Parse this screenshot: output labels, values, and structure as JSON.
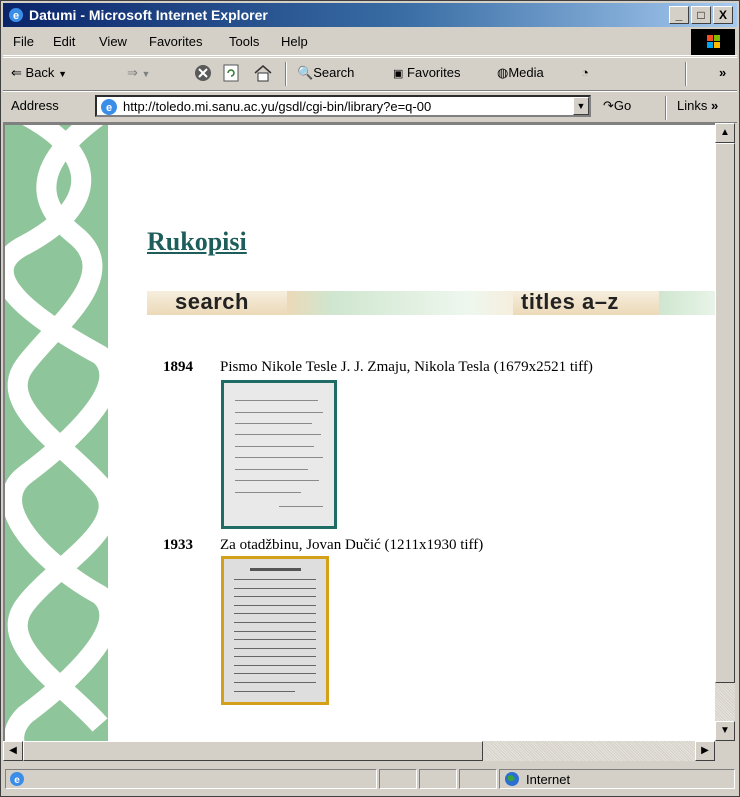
{
  "window": {
    "title": "Datumi - Microsoft Internet Explorer",
    "controls": {
      "minimize": "_",
      "maximize": "□",
      "close": "X"
    }
  },
  "menu": [
    "File",
    "Edit",
    "View",
    "Favorites",
    "Tools",
    "Help"
  ],
  "toolbar": {
    "back": "Back",
    "search": "Search",
    "favorites": "Favorites",
    "media": "Media",
    "more": "»"
  },
  "address": {
    "label": "Address",
    "url": "http://toledo.mi.sanu.ac.yu/gsdl/cgi-bin/library?e=q-00",
    "go": "Go",
    "links": "Links",
    "more": "»"
  },
  "page": {
    "title": "Rukopisi",
    "nav": {
      "search": "search",
      "titles": "titles a–z"
    },
    "entries": [
      {
        "year": "1894",
        "text": "Pismo Nikole Tesle J. J. Zmaju, Nikola Tesla (1679x2521 tiff)",
        "thumb_color": "#1f6b66"
      },
      {
        "year": "1933",
        "text": "Za otadžbinu, Jovan Dučić (1211x1930 tiff)",
        "thumb_color": "#d4a017"
      }
    ],
    "colors": {
      "band": "#8fc59a",
      "title": "#1e5e5a"
    }
  },
  "status": {
    "zone": "Internet"
  }
}
